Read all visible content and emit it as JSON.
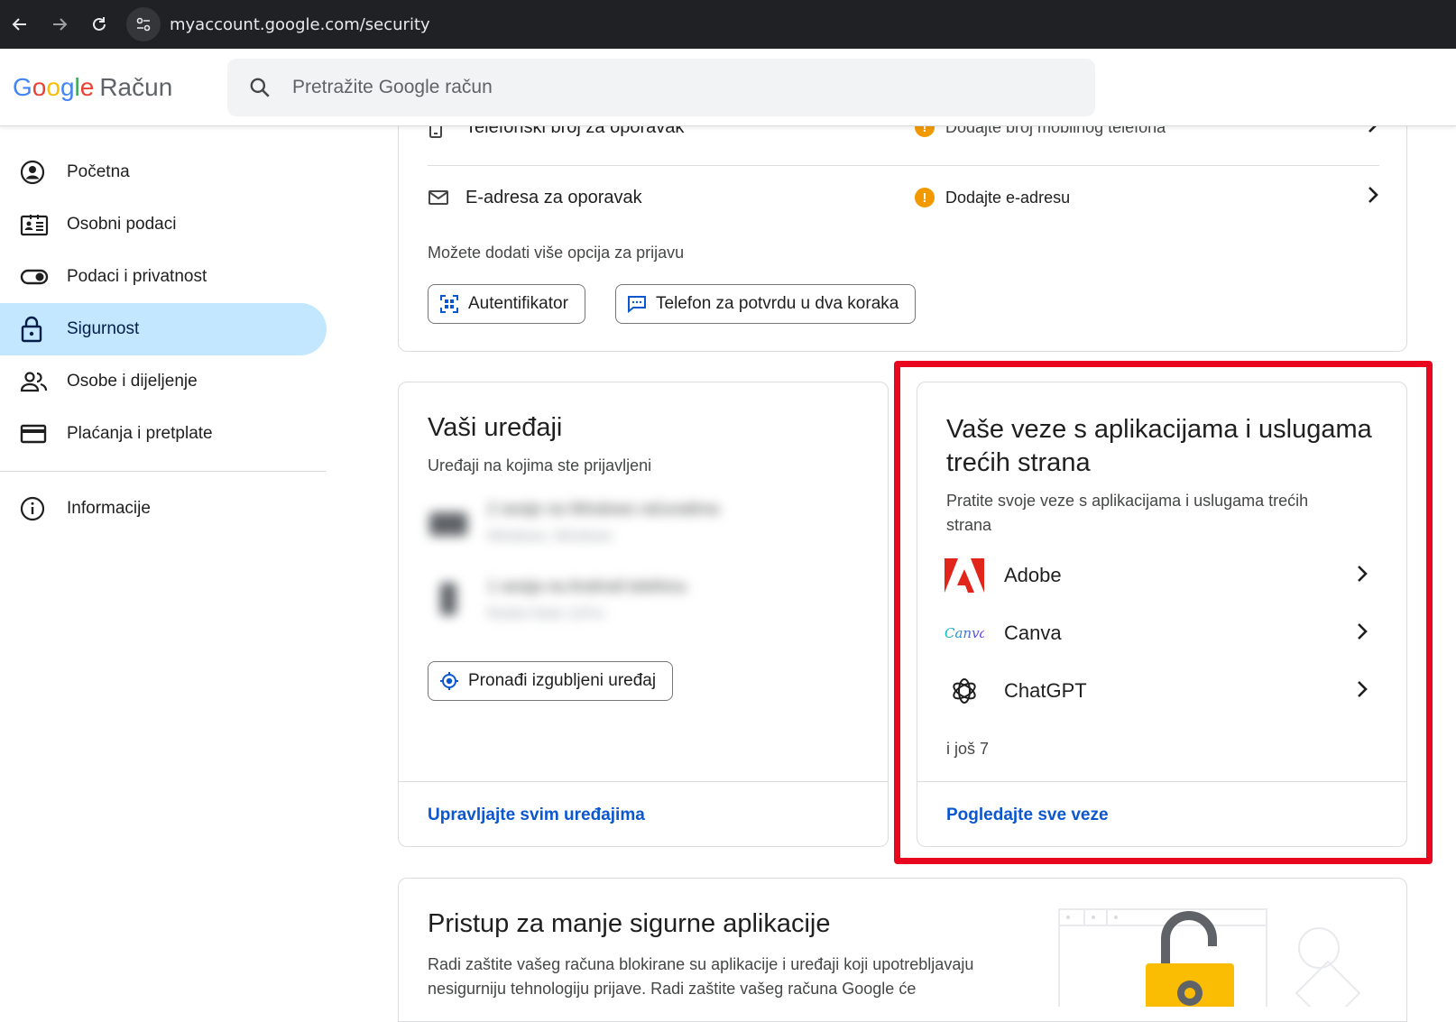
{
  "browser": {
    "url": "myaccount.google.com/security"
  },
  "header": {
    "logo_google": "Google",
    "logo_product": "Račun",
    "search_placeholder": "Pretražite Google račun"
  },
  "sidebar": {
    "items": [
      {
        "label": "Početna",
        "icon": "account-circle-icon"
      },
      {
        "label": "Osobni podaci",
        "icon": "id-card-icon"
      },
      {
        "label": "Podaci i privatnost",
        "icon": "toggle-icon"
      },
      {
        "label": "Sigurnost",
        "icon": "lock-icon",
        "active": true
      },
      {
        "label": "Osobe i dijeljenje",
        "icon": "people-icon"
      },
      {
        "label": "Plaćanja i pretplate",
        "icon": "credit-card-icon"
      },
      {
        "label": "Informacije",
        "icon": "info-icon"
      }
    ]
  },
  "recovery": {
    "phone_label": "Telefonski broj za oporavak",
    "phone_status": "Dodajte broj mobilnog telefona",
    "email_label": "E-adresa za oporavak",
    "email_status": "Dodajte e-adresu",
    "more_options_text": "Možete dodati više opcija za prijavu",
    "btn_authenticator": "Autentifikator",
    "btn_phone_2fa": "Telefon za potvrdu u dva koraka"
  },
  "devices": {
    "title": "Vaši uređaji",
    "subtitle": "Uređaji na kojima ste prijavljeni",
    "device1_title": "2 sesije na Windows računalima",
    "device1_sub": "Windows, Windows",
    "device2_title": "1 sesija na Android telefonu",
    "device2_sub": "Redmi Note 11Pro",
    "find_button": "Pronađi izgubljeni uređaj",
    "manage_link": "Upravljajte svim uređajima"
  },
  "connections": {
    "title": "Vaše veze s aplikacijama i uslugama trećih strana",
    "subtitle": "Pratite svoje veze s aplikacijama i uslugama trećih strana",
    "apps": [
      {
        "name": "Adobe",
        "icon": "adobe-icon"
      },
      {
        "name": "Canva",
        "icon": "canva-icon"
      },
      {
        "name": "ChatGPT",
        "icon": "chatgpt-icon"
      }
    ],
    "more_text": "i još 7",
    "see_all_link": "Pogledajte sve veze"
  },
  "less_secure": {
    "title": "Pristup za manje sigurne aplikacije",
    "body": "Radi zaštite vašeg računa blokirane su aplikacije i uređaji koji upotreblja­vaju nesigurniju tehnologiju prijave. Radi zaštite vašeg računa Google će"
  },
  "colors": {
    "accent_link": "#0b57d0",
    "active_nav_bg": "#c2e7ff",
    "warning": "#f29900",
    "highlight_box": "#e8071f"
  }
}
